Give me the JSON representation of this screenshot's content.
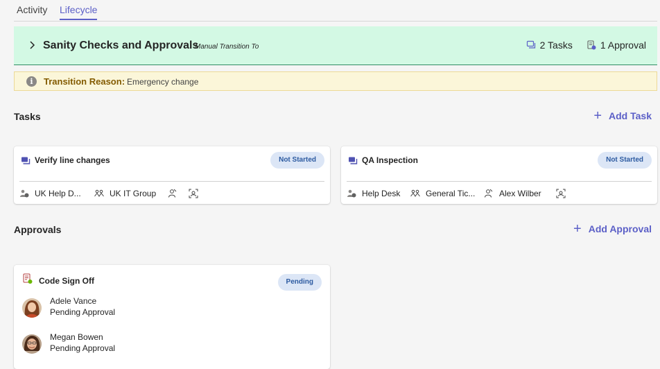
{
  "tabs": [
    {
      "label": "Activity"
    },
    {
      "label": "Lifecycle"
    }
  ],
  "stage": {
    "title": "Sanity Checks and Approvals",
    "subtitle": "Manual Transition To",
    "tasks_count": "2 Tasks",
    "approvals_count": "1 Approval",
    "accent_color": "#d3f9e4"
  },
  "reason": {
    "label": "Transition Reason:",
    "value": "Emergency change"
  },
  "tasks_section": {
    "title": "Tasks",
    "add_label": "Add Task",
    "cards": [
      {
        "title": "Verify line changes",
        "status": "Not Started",
        "group": "UK Help D...",
        "team": "UK IT Group",
        "assignee": ""
      },
      {
        "title": "QA Inspection",
        "status": "Not Started",
        "group": "Help Desk",
        "team": "General Tic...",
        "assignee": "Alex Wilber"
      }
    ]
  },
  "approvals_section": {
    "title": "Approvals",
    "add_label": "Add Approval",
    "card": {
      "title": "Code Sign Off",
      "status": "Pending",
      "approvers": [
        {
          "name": "Adele Vance",
          "status": "Pending Approval"
        },
        {
          "name": "Megan Bowen",
          "status": "Pending Approval"
        }
      ]
    }
  }
}
